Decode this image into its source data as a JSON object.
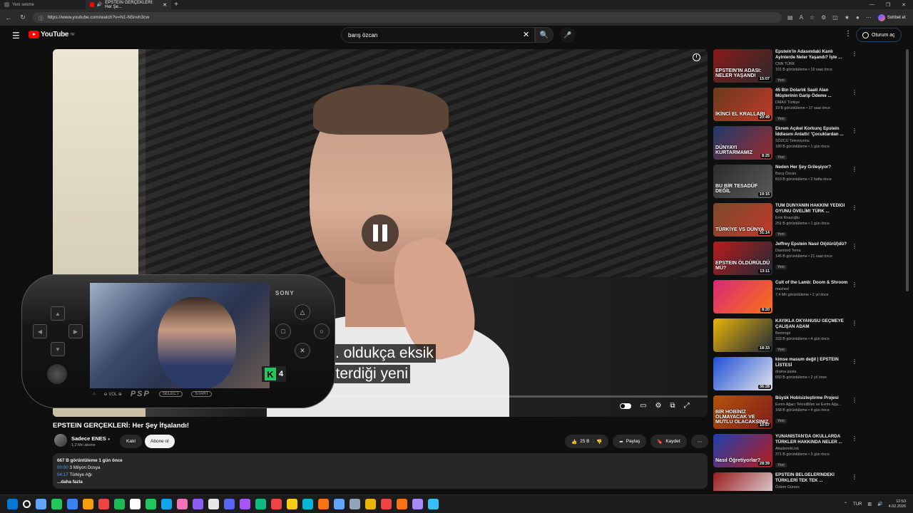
{
  "browser": {
    "tabs": [
      {
        "label": "Yeni sekme"
      },
      {
        "label": "EPSTEIN GERÇEKLERİ: Her Şe..."
      }
    ],
    "new_tab": "+",
    "window_controls": [
      "—",
      "❐",
      "✕"
    ],
    "url": "https://www.youtube.com/watch?v=N1-N5nvh3cw",
    "copilot_label": "Sohbet et"
  },
  "header": {
    "logo_text": "YouTube",
    "logo_sup": "TR",
    "search_value": "barış özcan",
    "signin_label": "Oturum aç"
  },
  "video": {
    "subtitle_line1": ". oldukça eksik",
    "subtitle_line2": "sterdiği yeni",
    "progress_fraction": 0.06,
    "overlay_badge": "4",
    "overlay_badge_logo": "K",
    "psp": {
      "brand": "SONY",
      "logo": "PSP",
      "vol": "VOL",
      "select": "SELECT",
      "start": "START"
    }
  },
  "meta": {
    "title": "EPSTEIN GERÇEKLERİ: Her Şey İfşalandı!",
    "channel": "Sadece ENES",
    "subscribers": "1,2 Mn abone",
    "join_label": "Katıl",
    "subscribe_label": "Abone ol",
    "likes": "25 B",
    "share_label": "Paylaş",
    "save_label": "Kaydet"
  },
  "description": {
    "meta_line": "667 B görüntüleme  1 gün önce",
    "chapters": [
      {
        "time": "00:00",
        "label": "3 Milyon Dosya"
      },
      {
        "time": "04:17",
        "label": "Türkiye Ağı"
      }
    ],
    "more_label": "...daha fazla"
  },
  "recommendations": [
    {
      "title": "Epstein'in Adasındaki Kanlı Ayinlerde Neler Yaşandı? İşte ...",
      "channel": "CNN TÜRK",
      "meta": "101 B görüntüleme • 19 saat önce",
      "badge": "Yeni",
      "duration": "15:07",
      "thumb_text": "EPSTEIN'IN ADASI: NELER YAŞANDI",
      "color1": "#8b1a1a",
      "color2": "#2a2a2a"
    },
    {
      "title": "45 Bin Dolarlık Saati Alan Müşterinin Garip Ödeme ...",
      "channel": "DMAX Türkiye",
      "meta": "19 B görüntüleme • 17 saat önce",
      "badge": "Yeni",
      "duration": "20:49",
      "thumb_text": "İKİNCİ EL KRALLARI",
      "color1": "#6b3b1b",
      "color2": "#c0392b"
    },
    {
      "title": "Ekrem Açıkel Korkunç Epstein İddiasını Anlattı! 'Çocuklardan ...",
      "channel": "SÖZCÜ Televizyonu",
      "meta": "180 B görüntüleme • 1 gün önce",
      "badge": "Yeni",
      "duration": "8:25",
      "thumb_text": "DÜNYAYI KURTARMAMIZ",
      "color1": "#1e3a6b",
      "color2": "#9b2c2c"
    },
    {
      "title": "Neden Her Şey Grileşiyor?",
      "channel": "Barış Özcan",
      "meta": "810 B görüntüleme • 2 hafta önce",
      "badge": "",
      "duration": "19:15",
      "thumb_text": "BU BİR TESADÜF DEĞİL",
      "color1": "#2c2c2c",
      "color2": "#5a5a5a"
    },
    {
      "title": "TÜM DÜNYANIN HAKKINI YEDİĞİ OYUNU ÖVELİM! TÜRK ...",
      "channel": "Enis Kirazoğlu",
      "meta": "251 B görüntüleme • 1 gün önce",
      "badge": "Yeni",
      "duration": "31:14",
      "thumb_text": "TÜRKİYE VS DÜNYA",
      "color1": "#7a4a2a",
      "color2": "#c0392b"
    },
    {
      "title": "Jeffrey Epstein Nasıl Öl(dürül)dü?",
      "channel": "Diamond Tema",
      "meta": "145 B görüntüleme • 21 saat önce",
      "badge": "Yeni",
      "duration": "13:11",
      "thumb_text": "EPSTEIN ÖLDÜRÜLDÜ MÜ?",
      "color1": "#b91c1c",
      "color2": "#1f2937"
    },
    {
      "title": "Cult of the Lamb: Doom & Shroom",
      "channel": "mashed",
      "meta": "7,4 Mn görüntüleme • 2 yıl önce",
      "badge": "",
      "duration": "8:20",
      "thumb_text": "",
      "color1": "#db2777",
      "color2": "#f97316"
    },
    {
      "title": "KAYIKLA OKYANUSU GEÇMEYE ÇALIŞAN ADAM",
      "channel": "Bentrogii",
      "meta": "333 B görüntüleme • 4 gün önce",
      "badge": "Yeni",
      "duration": "18:33",
      "thumb_text": "",
      "color1": "#eab308",
      "color2": "#1f2937"
    },
    {
      "title": "kimse masum değil | EPSTEIN LİSTESİ",
      "channel": "drama pasta",
      "meta": "650 B görüntüleme • 2 yıl önce",
      "badge": "",
      "duration": "36:28",
      "thumb_text": "",
      "color1": "#1d4ed8",
      "color2": "#e5e7eb"
    },
    {
      "title": "Büyük Hobisizleştirme Projesi",
      "channel": "Evrim Ağacı TeknoBilim ve Evrim Ağa...",
      "meta": "168 B görüntüleme • 4 gün önce",
      "badge": "Yeni",
      "duration": "10:57",
      "thumb_text": "BİR HOBİNİZ OLMAYACAK VE MUTLU OLACAKSINIZ",
      "color1": "#b45309",
      "color2": "#7f1d1d"
    },
    {
      "title": "YUNANİSTAN'DA OKULLARDA TÜRKLER HAKKINDA NELER ...",
      "channel": "AkademikLink",
      "meta": "371 B görüntüleme • 3 gün önce",
      "badge": "Yeni",
      "duration": "28:39",
      "thumb_text": "Nasıl Öğretiyorlar?",
      "color1": "#1e40af",
      "color2": "#b91c1c"
    },
    {
      "title": "EPSTEIN BELGELERİNDEKİ TÜRKLERİ TEK TEK ...",
      "channel": "Özlem Gürses",
      "meta": "633 B görüntüleme • 2 gün önce",
      "badge": "",
      "duration": "",
      "thumb_text": "EPSTEIN BELGELERİNDEKİ",
      "color1": "#991b1b",
      "color2": "#e5e7eb"
    }
  ],
  "taskbar": {
    "language": "TUR",
    "time": "12:53",
    "date": "4.02.2026"
  },
  "icons": {
    "taskbar_colors": [
      "#0078d4",
      "#ffffff",
      "#60a5fa",
      "#22c55e",
      "#3b82f6",
      "#f59e0b",
      "#ef4444",
      "#1db954",
      "#ffffff",
      "#22c55e",
      "#0ea5e9",
      "#f472b6",
      "#8b5cf6",
      "#e5e7eb",
      "#5865f2",
      "#a855f7",
      "#10b981",
      "#ef4444",
      "#facc15",
      "#06b6d4",
      "#f97316",
      "#60a5fa",
      "#94a3b8",
      "#eab308",
      "#ef4444",
      "#f97316",
      "#a78bfa",
      "#38bdf8"
    ]
  }
}
